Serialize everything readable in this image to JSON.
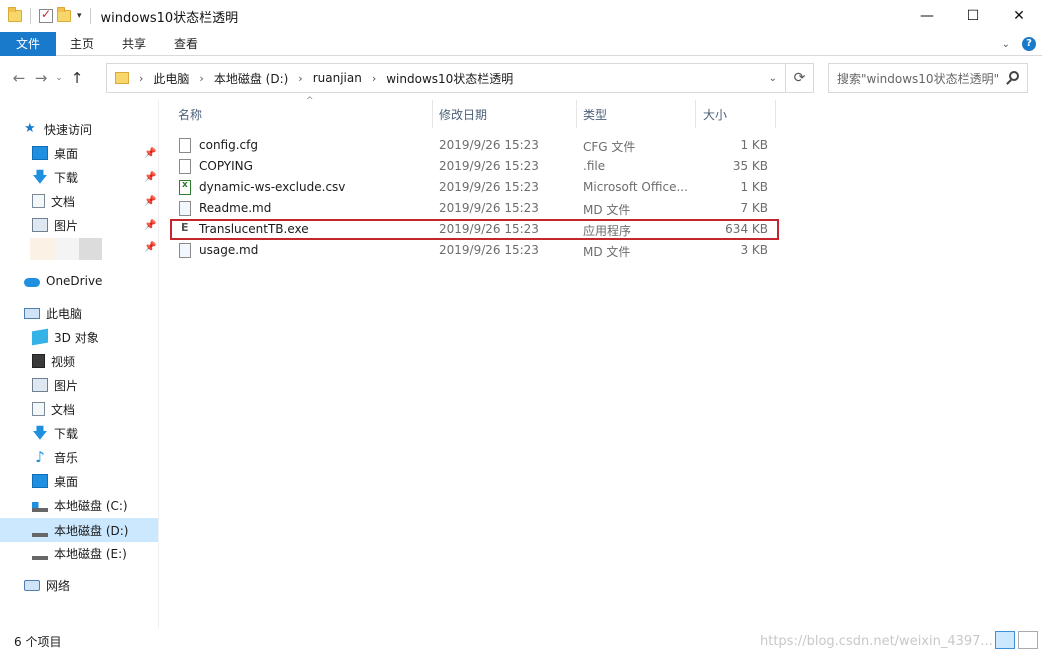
{
  "window": {
    "title": "windows10状态栏透明",
    "minimize": "—",
    "maximize": "☐",
    "close": "✕"
  },
  "ribbon": {
    "tabs": [
      "文件",
      "主页",
      "共享",
      "查看"
    ]
  },
  "nav": {
    "back": "←",
    "forward": "→",
    "recent": "⌄",
    "up": "↑",
    "breadcrumbs": [
      "此电脑",
      "本地磁盘 (D:)",
      "ruanjian",
      "windows10状态栏透明"
    ],
    "search_placeholder": "搜索\"windows10状态栏透明\""
  },
  "sidebar": {
    "quick_access": "快速访问",
    "pinned": [
      "桌面",
      "下载",
      "文档",
      "图片"
    ],
    "onedrive": "OneDrive",
    "this_pc": "此电脑",
    "pc_items": [
      "3D 对象",
      "视频",
      "图片",
      "文档",
      "下载",
      "音乐",
      "桌面",
      "本地磁盘 (C:)",
      "本地磁盘 (D:)",
      "本地磁盘 (E:)"
    ],
    "network": "网络"
  },
  "columns": {
    "name": "名称",
    "date": "修改日期",
    "type": "类型",
    "size": "大小"
  },
  "files": [
    {
      "name": "config.cfg",
      "date": "2019/9/26 15:23",
      "type": "CFG 文件",
      "size": "1 KB"
    },
    {
      "name": "COPYING",
      "date": "2019/9/26 15:23",
      "type": ".file",
      "size": "35 KB"
    },
    {
      "name": "dynamic-ws-exclude.csv",
      "date": "2019/9/26 15:23",
      "type": "Microsoft Office...",
      "size": "1 KB"
    },
    {
      "name": "Readme.md",
      "date": "2019/9/26 15:23",
      "type": "MD 文件",
      "size": "7 KB"
    },
    {
      "name": "TranslucentTB.exe",
      "date": "2019/9/26 15:23",
      "type": "应用程序",
      "size": "634 KB"
    },
    {
      "name": "usage.md",
      "date": "2019/9/26 15:23",
      "type": "MD 文件",
      "size": "3 KB"
    }
  ],
  "status": {
    "count": "6 个项目",
    "watermark": "https://blog.csdn.net/weixin_4397..."
  },
  "colors": {
    "accent": "#1979ca",
    "selection": "#cce8ff",
    "highlight_box": "#c4262e"
  }
}
